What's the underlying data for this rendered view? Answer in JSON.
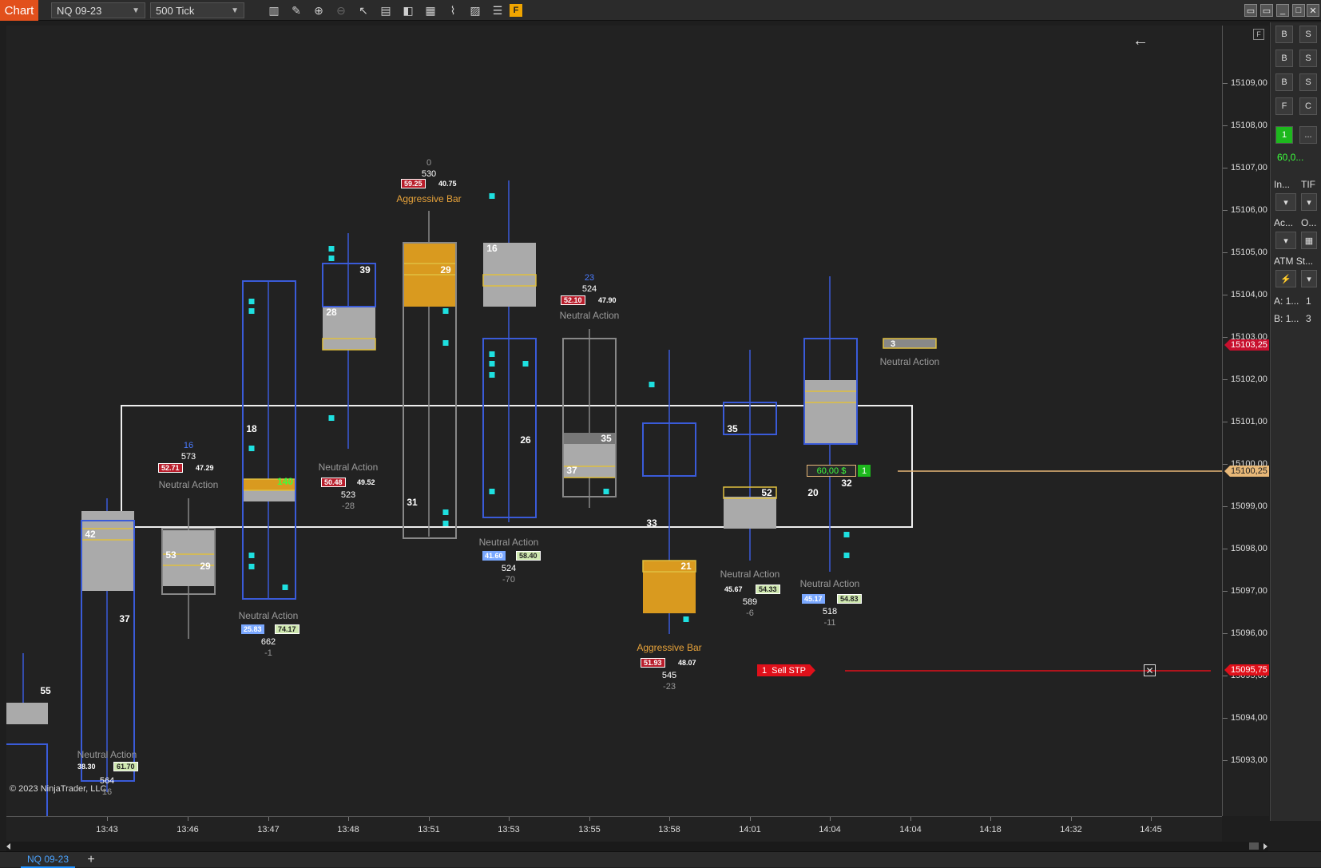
{
  "toolbar": {
    "chart_tab": "Chart",
    "instrument": "NQ 09-23",
    "interval": "500 Tick",
    "f_badge": "F",
    "icons": [
      "bars-icon",
      "pencil-icon",
      "zoom-in-icon",
      "zoom-out-icon",
      "pointer-icon",
      "data-box-icon",
      "properties-icon",
      "templates-icon",
      "strategies-icon",
      "indicators-icon",
      "list-icon"
    ]
  },
  "price_axis": {
    "labels": [
      "15109,00",
      "15108,00",
      "15107,00",
      "15106,00",
      "15105,00",
      "15104,00",
      "15103,00",
      "15102,00",
      "15101,00",
      "15100,00",
      "15099,00",
      "15098,00",
      "15097,00",
      "15096,00",
      "15095,00",
      "15094,00",
      "15093,00"
    ],
    "last_price": "15100,25",
    "ask_tag": "15103,25",
    "stop_tag": "15095,75"
  },
  "time_axis": {
    "labels": [
      "13:43",
      "13:46",
      "13:47",
      "13:48",
      "13:51",
      "13:53",
      "13:55",
      "13:58",
      "14:01",
      "14:04",
      "14:04",
      "14:18",
      "14:32",
      "14:45"
    ]
  },
  "side_panel": {
    "buttons": [
      "B",
      "S",
      "B",
      "S",
      "B",
      "S",
      "F",
      "C"
    ],
    "qty": "1",
    "qty_more": "...",
    "pnl": "60,0...",
    "instrument_lbl": "In...",
    "tif_lbl": "TIF",
    "account_lbl": "Ac...",
    "o_lbl": "O...",
    "atm_lbl": "ATM St...",
    "a_lbl": "A:",
    "a_val": "1...",
    "a_num": "1",
    "b_lbl": "B:",
    "b_val": "1...",
    "b_num": "3"
  },
  "bars": [
    {
      "label": "Neutral Action",
      "delta_top": "",
      "vol": "564",
      "delta": "16",
      "left_badge": "38.30",
      "right_badge": "61.70"
    },
    {
      "label": "Neutral Action",
      "delta_top": "16",
      "vol": "573",
      "delta": "",
      "left_badge": "52.71",
      "right_badge": "47.29"
    },
    {
      "label": "Neutral Action",
      "delta_top": "",
      "vol": "662",
      "delta": "-1",
      "left_badge": "25.83",
      "right_badge": "74.17"
    },
    {
      "label": "Neutral Action",
      "delta_top": "",
      "vol": "523",
      "delta": "-28",
      "left_badge": "50.48",
      "right_badge": "49.52"
    },
    {
      "label": "Aggressive Bar",
      "delta_top": "0",
      "vol": "530",
      "delta": "",
      "left_badge": "59.25",
      "right_badge": "40.75"
    },
    {
      "label": "Neutral Action",
      "delta_top": "",
      "vol": "524",
      "delta": "-70",
      "left_badge": "41.60",
      "right_badge": "58.40"
    },
    {
      "label": "Neutral Action",
      "delta_top": "23",
      "vol": "524",
      "delta": "",
      "left_badge": "52.10",
      "right_badge": "47.90"
    },
    {
      "label": "Aggressive Bar",
      "delta_top": "",
      "vol": "545",
      "delta": "-23",
      "left_badge": "51.93",
      "right_badge": "48.07"
    },
    {
      "label": "Neutral Action",
      "delta_top": "",
      "vol": "589",
      "delta": "-6",
      "left_badge": "45.67",
      "right_badge": "54.33"
    },
    {
      "label": "Neutral Action",
      "delta_top": "",
      "vol": "518",
      "delta": "-11",
      "left_badge": "45.17",
      "right_badge": "54.83"
    },
    {
      "label": "Neutral Action",
      "delta_top": "",
      "vol": "",
      "delta": "",
      "left_badge": "",
      "right_badge": ""
    }
  ],
  "forming_bar_vol": "3",
  "position_tag": {
    "pnl": "60,00 $",
    "qty": "1"
  },
  "stop_order": {
    "qty": "1",
    "label": "Sell STP"
  },
  "copyright": "© 2023 NinjaTrader, LLC",
  "bottom_tab": "NQ 09-23",
  "colors": {
    "accent": "#e2501c",
    "bull": "#3a5bd9",
    "agg": "#d99a1f",
    "cyan": "#1ee0e0",
    "stop": "#e0101a"
  }
}
